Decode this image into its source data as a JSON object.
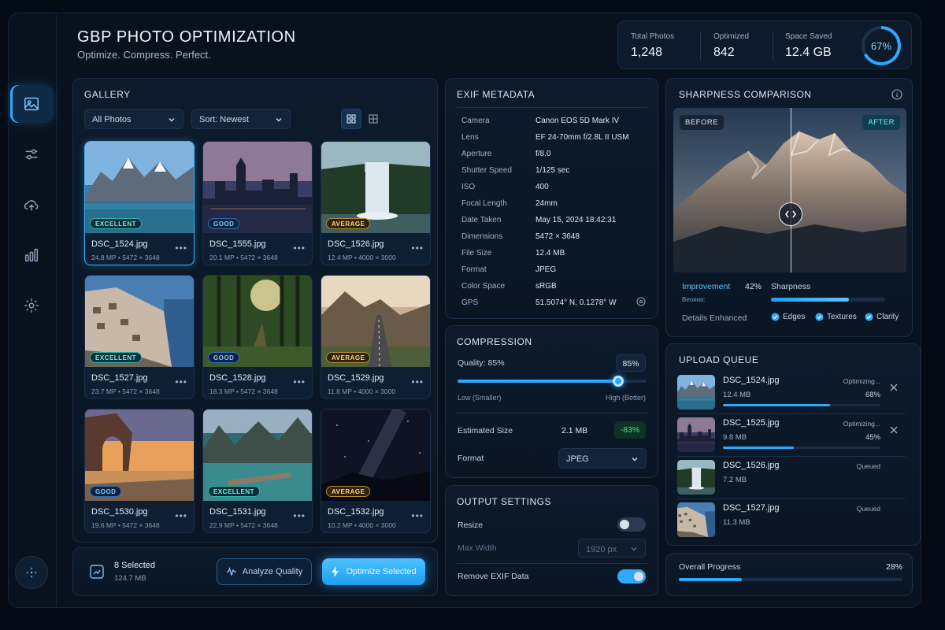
{
  "header": {
    "title": "GBP PHOTO OPTIMIZATION",
    "subtitle": "Optimize. Compress. Perfect."
  },
  "stats": {
    "total_label": "Total Photos",
    "total_value": "1,248",
    "optimized_label": "Optimized",
    "optimized_value": "842",
    "saved_label": "Space Saved",
    "saved_value": "12.4 GB",
    "ring_label": "67%",
    "ring_fraction": 0.67
  },
  "sidebar": {
    "items": [
      "image-icon",
      "sliders-icon",
      "cloud-upload-icon",
      "bar-chart-icon",
      "gear-icon"
    ],
    "active": 0
  },
  "gallery": {
    "title": "GALLERY",
    "filter": "All Photos",
    "sort": "Sort: Newest",
    "cards": [
      {
        "name": "DSC_1524.jpg",
        "meta": "24.8 MP  •  5472 × 3648",
        "badge": "EXCELLENT",
        "kind": "ex",
        "scene": "lake",
        "selected": true
      },
      {
        "name": "DSC_1555.jpg",
        "meta": "20.1 MP  •  5472 × 3648",
        "badge": "GOOD",
        "kind": "gd",
        "scene": "city",
        "selected": false
      },
      {
        "name": "DSC_1526.jpg",
        "meta": "12.4 MP  •  4000 × 3000",
        "badge": "AVERAGE",
        "kind": "av",
        "scene": "waterfall",
        "selected": false
      },
      {
        "name": "DSC_1527.jpg",
        "meta": "23.7 MP  •  5472 × 3648",
        "badge": "EXCELLENT",
        "kind": "ex",
        "scene": "village",
        "selected": false
      },
      {
        "name": "DSC_1528.jpg",
        "meta": "18.3 MP  •  5472 × 3648",
        "badge": "GOOD",
        "kind": "gd",
        "scene": "forest",
        "selected": false
      },
      {
        "name": "DSC_1529.jpg",
        "meta": "11.8 MP  •  4000 × 3000",
        "badge": "AVERAGE",
        "kind": "av",
        "scene": "road",
        "selected": false
      },
      {
        "name": "DSC_1530.jpg",
        "meta": "19.6 MP  •  5472 × 3648",
        "badge": "GOOD",
        "kind": "gd",
        "scene": "arch",
        "selected": false
      },
      {
        "name": "DSC_1531.jpg",
        "meta": "22.9 MP  •  5472 × 3648",
        "badge": "EXCELLENT",
        "kind": "ex",
        "scene": "pier",
        "selected": false
      },
      {
        "name": "DSC_1532.jpg",
        "meta": "10.2 MP  •  4000 × 3000",
        "badge": "AVERAGE",
        "kind": "av",
        "scene": "night",
        "selected": false
      }
    ]
  },
  "selection": {
    "count": "8 Selected",
    "size": "124.7 MB",
    "analyze": "Analyze Quality",
    "optimize": "Optimize Selected"
  },
  "exif": {
    "title": "EXIF METADATA",
    "rows": [
      {
        "k": "Camera",
        "v": "Canon EOS 5D Mark IV"
      },
      {
        "k": "Lens",
        "v": "EF 24-70mm f/2.8L II USM"
      },
      {
        "k": "Aperture",
        "v": "f/8.0"
      },
      {
        "k": "Shutter Speed",
        "v": "1/125 sec"
      },
      {
        "k": "ISO",
        "v": "400"
      },
      {
        "k": "Focal Length",
        "v": "24mm"
      },
      {
        "k": "Date Taken",
        "v": "May 15, 2024 18:42:31"
      },
      {
        "k": "Dimensions",
        "v": "5472 × 3648"
      },
      {
        "k": "File Size",
        "v": "12.4 MB"
      },
      {
        "k": "Format",
        "v": "JPEG"
      },
      {
        "k": "Color Space",
        "v": "sRGB"
      },
      {
        "k": "GPS",
        "v": "51.5074° N, 0.1278° W"
      }
    ]
  },
  "compression": {
    "title": "COMPRESSION",
    "quality_label": "Quality: 85%",
    "quality_value": "85%",
    "quality_fraction": 0.85,
    "low": "Low (Smaller)",
    "high": "High (Better)",
    "est_label": "Estimated Size",
    "est_value": "2.1 MB",
    "est_delta": "-83%",
    "format_label": "Format",
    "format_value": "JPEG"
  },
  "output": {
    "title": "OUTPUT SETTINGS",
    "resize_label": "Resize",
    "resize_on": false,
    "maxw_label": "Max Width",
    "maxw_value": "1920 px",
    "exif_label": "Remove EXIF Data",
    "exif_on": true
  },
  "sharpness": {
    "title": "SHARPNESS COMPARISON",
    "before": "BEFORE",
    "after": "AFTER",
    "improvement_label": "Improvement",
    "improvement_value": "42%",
    "sharpness_label": "Sharpness",
    "sharpness_sub": "Bеᴏᴎᴎɑ:",
    "sharpness_fraction": 0.68,
    "details_label": "Details Enhanced",
    "checks": [
      "Edges",
      "Textures",
      "Clarity"
    ]
  },
  "queue": {
    "title": "UPLOAD QUEUE",
    "items": [
      {
        "name": "DSC_1524.jpg",
        "size": "12.4 MB",
        "status": "Optimizing...",
        "pct": "68%",
        "fraction": 0.68,
        "scene": "lake"
      },
      {
        "name": "DSC_1525.jpg",
        "size": "9.8 MB",
        "status": "Optimizing...",
        "pct": "45%",
        "fraction": 0.45,
        "scene": "city"
      },
      {
        "name": "DSC_1526.jpg",
        "size": "7.2 MB",
        "status": "Queued",
        "pct": "",
        "fraction": 0,
        "scene": "waterfall"
      },
      {
        "name": "DSC_1527.jpg",
        "size": "11.3 MB",
        "status": "Queued",
        "pct": "",
        "fraction": 0,
        "scene": "village"
      }
    ]
  },
  "overall": {
    "label": "Overall Progress",
    "pct": "28%",
    "fraction": 0.28
  },
  "colors": {
    "accent": "#2fa8ff",
    "excellent": "#6ff0e0",
    "good": "#8cc5ff",
    "average": "#ffd27a",
    "success": "#4ee08a"
  }
}
